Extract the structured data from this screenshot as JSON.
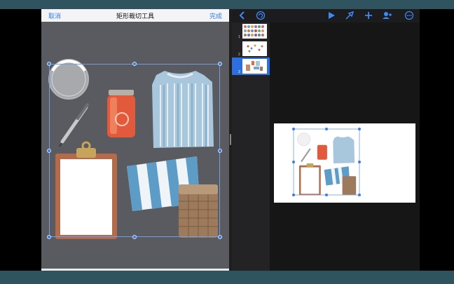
{
  "crop_tool": {
    "cancel_label": "取消",
    "title": "矩形裁切工具",
    "done_label": "完成"
  },
  "keynote": {
    "toolbar": {
      "back_icon": "chevron-left-icon",
      "undo_icon": "undo-icon",
      "play_icon": "play-icon",
      "format_icon": "paintbrush-icon",
      "add_icon": "plus-icon",
      "collaborate_icon": "person-add-icon",
      "more_icon": "ellipsis-icon"
    },
    "slides": [
      {
        "number": "1"
      },
      {
        "number": "2"
      },
      {
        "number": "3",
        "selected": true
      }
    ]
  },
  "colors": {
    "accent": "#3d8af7",
    "crop_background": "#595b60",
    "frame": "#2f5460",
    "selection_handle": "#3b7de0"
  }
}
